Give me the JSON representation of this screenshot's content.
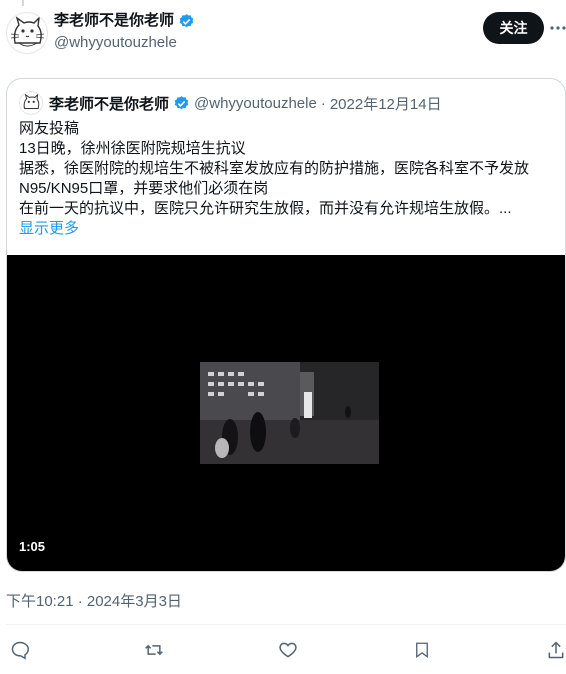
{
  "author": {
    "name": "李老师不是你老师",
    "handle": "@whyyoutouzhele",
    "follow_label": "关注",
    "verified_icon": "verified-badge-icon",
    "avatar_icon": "cat-sketch-avatar"
  },
  "quote": {
    "name": "李老师不是你老师",
    "handle": "@whyyoutouzhele",
    "separator": "·",
    "date": "2022年12月14日",
    "lines": [
      "网友投稿",
      "13日晚，徐州徐医附院规培生抗议",
      "据悉，徐医附院的规培生不被科室发放应有的防护措施，医院各科室不予发放",
      "N95/KN95口罩，并要求他们必须在岗",
      "在前一天的抗议中，医院只允许研究生放假，而并没有允许规培生放假。..."
    ],
    "show_more": "显示更多",
    "video_duration": "1:05"
  },
  "timestamp": "下午10:21 · 2024年3月3日",
  "actions": {
    "icons": [
      "reply-icon",
      "retweet-icon",
      "like-icon",
      "bookmark-icon",
      "share-icon"
    ]
  },
  "colors": {
    "text": "#0f1419",
    "secondary": "#536471",
    "link": "#1d9bf0",
    "border": "#cfd9de"
  }
}
